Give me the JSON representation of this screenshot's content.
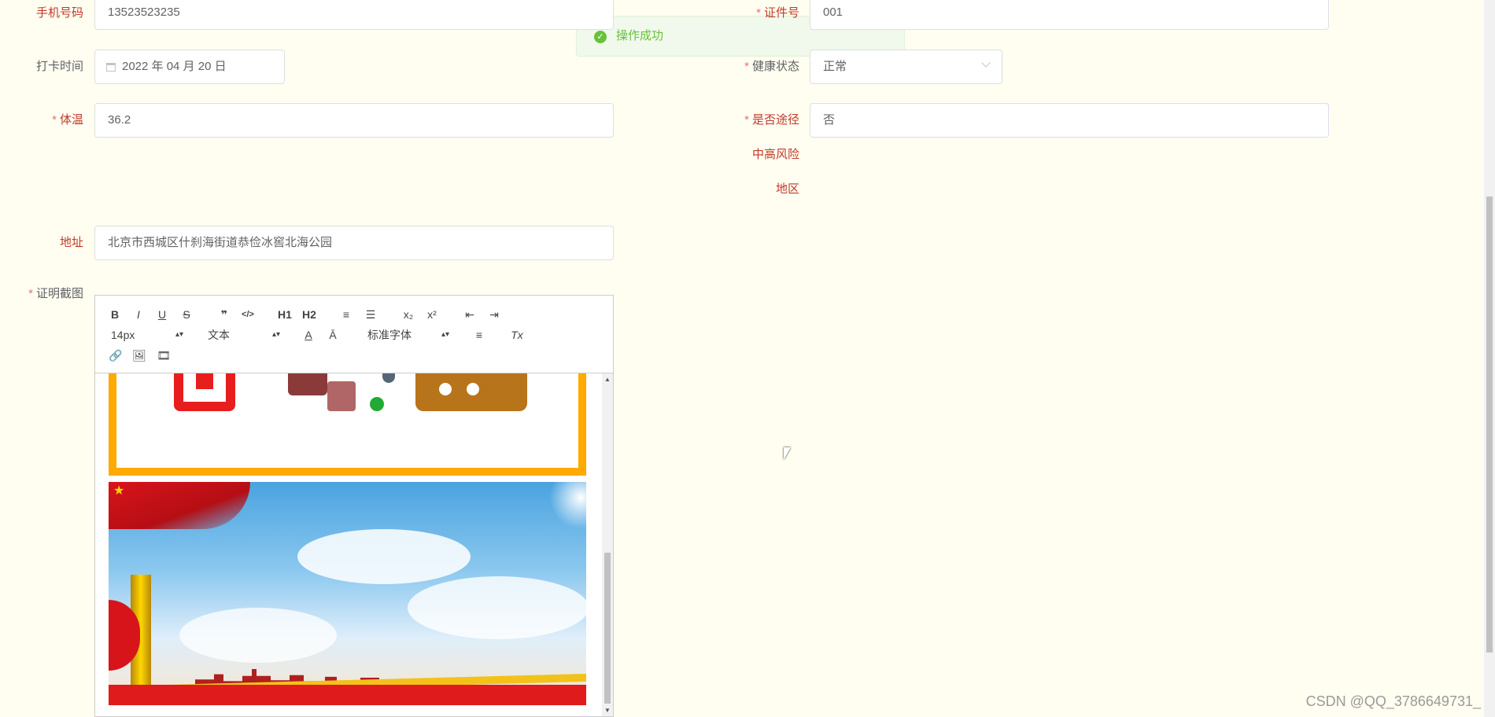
{
  "form": {
    "phone_label": "手机号码",
    "phone_value": "13523523235",
    "id_label": "证件号",
    "id_value": "001",
    "checkin_label": "打卡时间",
    "checkin_value": "2022 年 04 月 20 日",
    "health_label": "健康状态",
    "health_value": "正常",
    "temp_label": "体温",
    "temp_value": "36.2",
    "route_label_line1": "是否途径",
    "route_label_line2": "中高风险",
    "route_label_line3": "地区",
    "route_value": "否",
    "address_label": "地址",
    "address_value": "北京市西城区什刹海街道恭俭冰窖北海公园",
    "proof_label": "证明截图",
    "required_mark": "*"
  },
  "toast": {
    "message": "操作成功",
    "icon": "check-circle-icon"
  },
  "editor": {
    "font_size": "14px",
    "format": "文本",
    "font_family": "标准字体",
    "buttons": [
      "B",
      "I",
      "U",
      "S",
      "❞",
      "</>",
      "H1",
      "H2",
      "≡",
      "☰",
      "x₂",
      "x²",
      "⇤",
      "⇥",
      "A",
      "Ā",
      "≡",
      "Tx",
      "🔗",
      "🖼",
      "🎞"
    ]
  },
  "watermark": "CSDN @QQ_3786649731_"
}
